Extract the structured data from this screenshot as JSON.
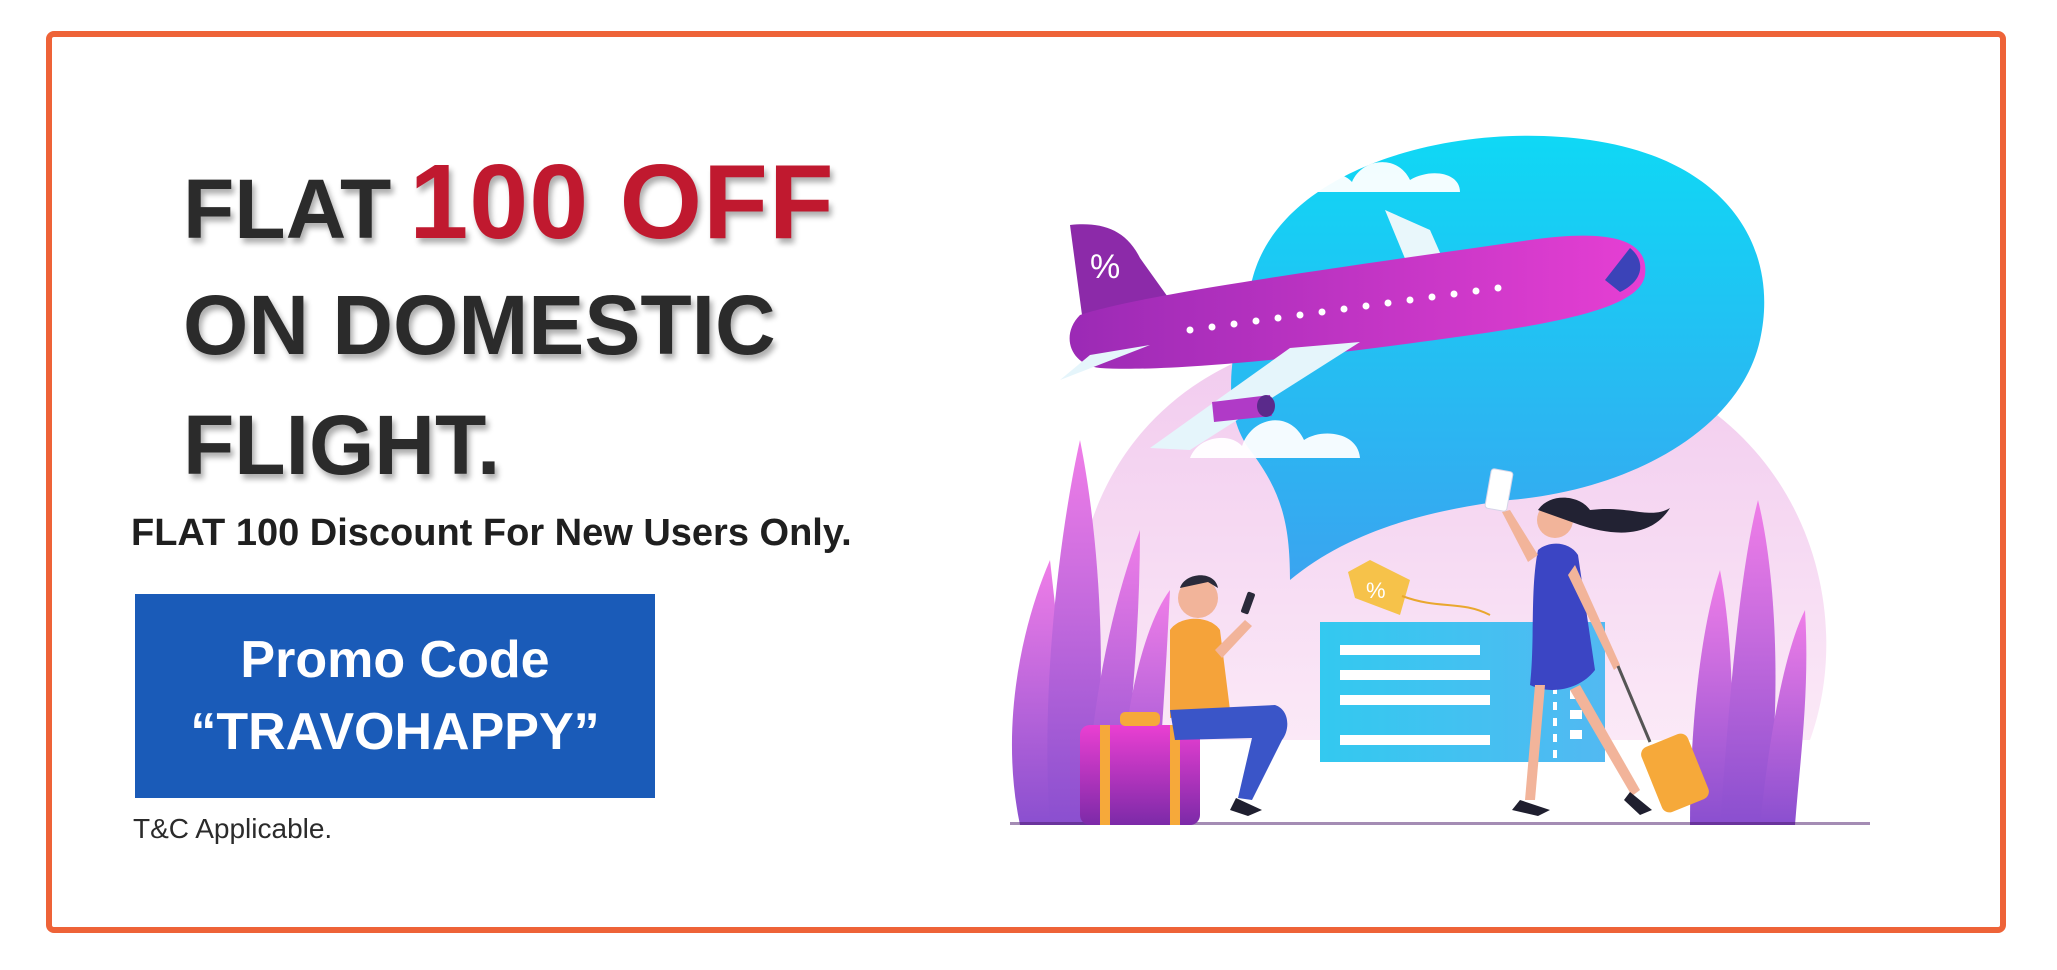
{
  "banner": {
    "headline": {
      "line1_prefix": "FLAT",
      "line1_accent": "100 OFF",
      "line2": "ON DOMESTIC",
      "line3": "FLIGHT."
    },
    "subheadline": "FLAT 100 Discount For New Users Only.",
    "promo": {
      "line1": "Promo Code",
      "line2": "“TRAVOHAPPY”"
    },
    "terms": "T&C Applicable.",
    "illustration": {
      "tail_badge": "%",
      "tag_badge": "%"
    }
  },
  "colors": {
    "border": "#ee6338",
    "accent_red": "#c0192f",
    "promo_blue": "#1a5bb8",
    "headline_text": "#2b2b2b"
  }
}
